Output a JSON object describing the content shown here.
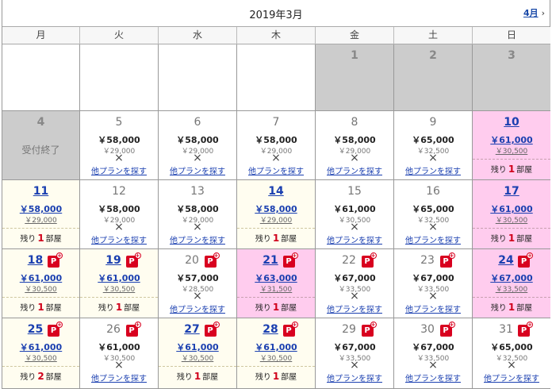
{
  "header": {
    "title": "2019年3月",
    "next_label": "4月",
    "next_chevron": "›"
  },
  "weekdays": [
    "月",
    "火",
    "水",
    "木",
    "金",
    "土",
    "日"
  ],
  "labels": {
    "closed": "受付終了",
    "other_plans": "他プランを探す",
    "remaining_prefix": "残り",
    "remaining_suffix": "部屋",
    "unavailable": "×",
    "p_badge": "P"
  },
  "colors": {
    "past": "#cccccc",
    "pink": "#ffccee",
    "cream": "#fffdf0",
    "link": "#1a3fb0",
    "badge": "#d8001f"
  },
  "rows": [
    [
      {
        "type": "empty"
      },
      {
        "type": "empty"
      },
      {
        "type": "empty"
      },
      {
        "type": "empty"
      },
      {
        "type": "past",
        "day": "1"
      },
      {
        "type": "past",
        "day": "2"
      },
      {
        "type": "past",
        "day": "3"
      }
    ],
    [
      {
        "type": "past",
        "day": "4",
        "closed": true
      },
      {
        "type": "soldout",
        "day": "5",
        "price": "￥58,000",
        "sub": "￥29,000"
      },
      {
        "type": "soldout",
        "day": "6",
        "price": "￥58,000",
        "sub": "￥29,000"
      },
      {
        "type": "soldout",
        "day": "7",
        "price": "￥58,000",
        "sub": "￥29,000"
      },
      {
        "type": "soldout",
        "day": "8",
        "price": "￥58,000",
        "sub": "￥29,000"
      },
      {
        "type": "soldout",
        "day": "9",
        "price": "￥65,000",
        "sub": "￥32,500"
      },
      {
        "type": "avail",
        "bg": "pink",
        "day": "10",
        "price": "￥61,000",
        "sub": "￥30,500",
        "remaining": "1"
      }
    ],
    [
      {
        "type": "avail",
        "bg": "cream",
        "day": "11",
        "price": "￥58,000",
        "sub": "￥29,000",
        "remaining": "1"
      },
      {
        "type": "soldout",
        "day": "12",
        "price": "￥58,000",
        "sub": "￥29,000"
      },
      {
        "type": "soldout",
        "day": "13",
        "price": "￥58,000",
        "sub": "￥29,000"
      },
      {
        "type": "avail",
        "bg": "cream",
        "day": "14",
        "price": "￥58,000",
        "sub": "￥29,000",
        "remaining": "1"
      },
      {
        "type": "soldout",
        "day": "15",
        "price": "￥61,000",
        "sub": "￥30,500"
      },
      {
        "type": "soldout",
        "day": "16",
        "price": "￥65,000",
        "sub": "￥32,500"
      },
      {
        "type": "avail",
        "bg": "pink",
        "day": "17",
        "price": "￥61,000",
        "sub": "￥30,500",
        "remaining": "1"
      }
    ],
    [
      {
        "type": "avail",
        "bg": "cream",
        "day": "18",
        "p": true,
        "price": "￥61,000",
        "sub": "￥30,500",
        "remaining": "1"
      },
      {
        "type": "avail",
        "bg": "cream",
        "day": "19",
        "p": true,
        "price": "￥61,000",
        "sub": "￥30,500",
        "remaining": "1"
      },
      {
        "type": "soldout",
        "day": "20",
        "p": true,
        "price": "￥57,000",
        "sub": "￥28,500"
      },
      {
        "type": "avail",
        "bg": "pink",
        "day": "21",
        "p": true,
        "price": "￥63,000",
        "sub": "￥31,500",
        "remaining": "1"
      },
      {
        "type": "soldout",
        "day": "22",
        "p": true,
        "price": "￥67,000",
        "sub": "￥33,500"
      },
      {
        "type": "soldout",
        "day": "23",
        "p": true,
        "price": "￥67,000",
        "sub": "￥33,500"
      },
      {
        "type": "avail",
        "bg": "pink",
        "day": "24",
        "p": true,
        "price": "￥67,000",
        "sub": "￥33,500",
        "remaining": "1"
      }
    ],
    [
      {
        "type": "avail",
        "bg": "cream",
        "day": "25",
        "p": true,
        "price": "￥61,000",
        "sub": "￥30,500",
        "remaining": "2"
      },
      {
        "type": "soldout",
        "day": "26",
        "p": true,
        "price": "￥61,000",
        "sub": "￥30,500"
      },
      {
        "type": "avail",
        "bg": "cream",
        "day": "27",
        "p": true,
        "price": "￥61,000",
        "sub": "￥30,500",
        "remaining": "1"
      },
      {
        "type": "avail",
        "bg": "cream",
        "day": "28",
        "p": true,
        "price": "￥61,000",
        "sub": "￥30,500",
        "remaining": "1"
      },
      {
        "type": "soldout",
        "day": "29",
        "p": true,
        "price": "￥67,000",
        "sub": "￥33,500"
      },
      {
        "type": "soldout",
        "day": "30",
        "p": true,
        "price": "￥67,000",
        "sub": "￥33,500"
      },
      {
        "type": "soldout",
        "day": "31",
        "p": true,
        "price": "￥65,000",
        "sub": "￥32,500"
      }
    ]
  ]
}
